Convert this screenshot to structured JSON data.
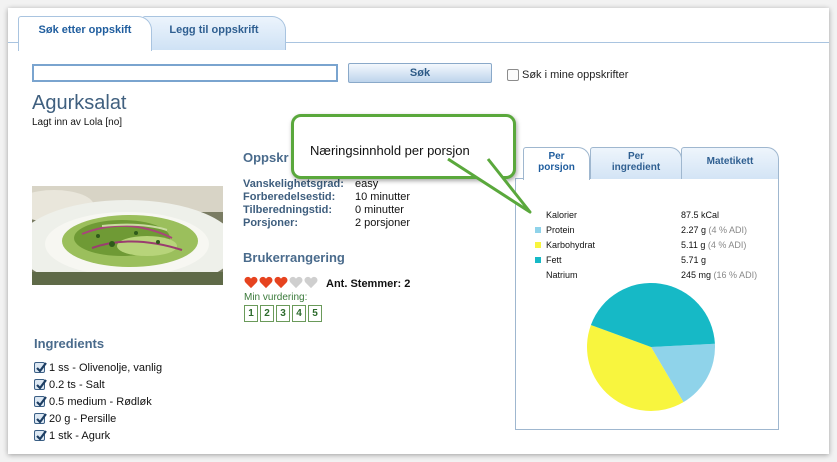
{
  "tabs": {
    "search_label": "Søk etter oppskift",
    "add_label": "Legg til oppskrift"
  },
  "search": {
    "value": "",
    "button_label": "Søk",
    "mine_label": "Søk i mine oppskrifter",
    "mine_checked": false
  },
  "recipe": {
    "title": "Agurksalat",
    "added_by": "Lagt inn av Lola [no]"
  },
  "info": {
    "heading": "Oppskr",
    "rows": [
      {
        "label": "Vanskelighetsgrad:",
        "value": "easy"
      },
      {
        "label": "Forberedelsestid:",
        "value": "10 minutter"
      },
      {
        "label": "Tilberedningstid:",
        "value": "0 minutter"
      },
      {
        "label": "Porsjoner:",
        "value": "2 porsjoner"
      }
    ]
  },
  "rating": {
    "heading": "Brukerrangering",
    "filled_hearts": 3,
    "total_hearts": 5,
    "votes": "Ant. Stemmer: 2",
    "my_label": "Min vurdering:",
    "options": [
      "1",
      "2",
      "3",
      "4",
      "5"
    ]
  },
  "ingredients": {
    "heading": "Ingredients",
    "items": [
      "1 ss - Olivenolje, vanlig",
      "0.2 ts - Salt",
      "0.5 medium - Rødløk",
      "20 g - Persille",
      "1 stk - Agurk"
    ]
  },
  "nutrition": {
    "tabs": {
      "per_serving_line1": "Per",
      "per_serving_line2": "porsjon",
      "per_ingredient_line1": "Per",
      "per_ingredient_line2": "ingredient",
      "food_tag": "Matetikett"
    },
    "rows": [
      {
        "name": "Kalorier",
        "value": "87.5 kCal",
        "adi": "",
        "color": ""
      },
      {
        "name": "Protein",
        "value": "2.27 g",
        "adi": "(4 % ADI)",
        "color": "#8fd3ea"
      },
      {
        "name": "Karbohydrat",
        "value": "5.11 g",
        "adi": "(4 % ADI)",
        "color": "#f8f53e"
      },
      {
        "name": "Fett",
        "value": "5.71 g",
        "adi": "",
        "color": "#16b9c6"
      },
      {
        "name": "Natrium",
        "value": "245 mg",
        "adi": "(16 % ADI)",
        "color": ""
      }
    ]
  },
  "chart_data": {
    "type": "pie",
    "categories": [
      "Protein",
      "Karbohydrat",
      "Fett"
    ],
    "values": [
      2.27,
      5.11,
      5.71
    ],
    "colors": [
      "#8fd3ea",
      "#f8f53e",
      "#16b9c6"
    ]
  },
  "callout": {
    "text": "Næringsinnhold per porsjon"
  },
  "colors": {
    "accent": "#1f5d9e",
    "heading": "#4a6b8c",
    "heart_filled": "#e6431f",
    "heart_empty": "#cfcfcf",
    "callout_border": "#5aa83c"
  }
}
